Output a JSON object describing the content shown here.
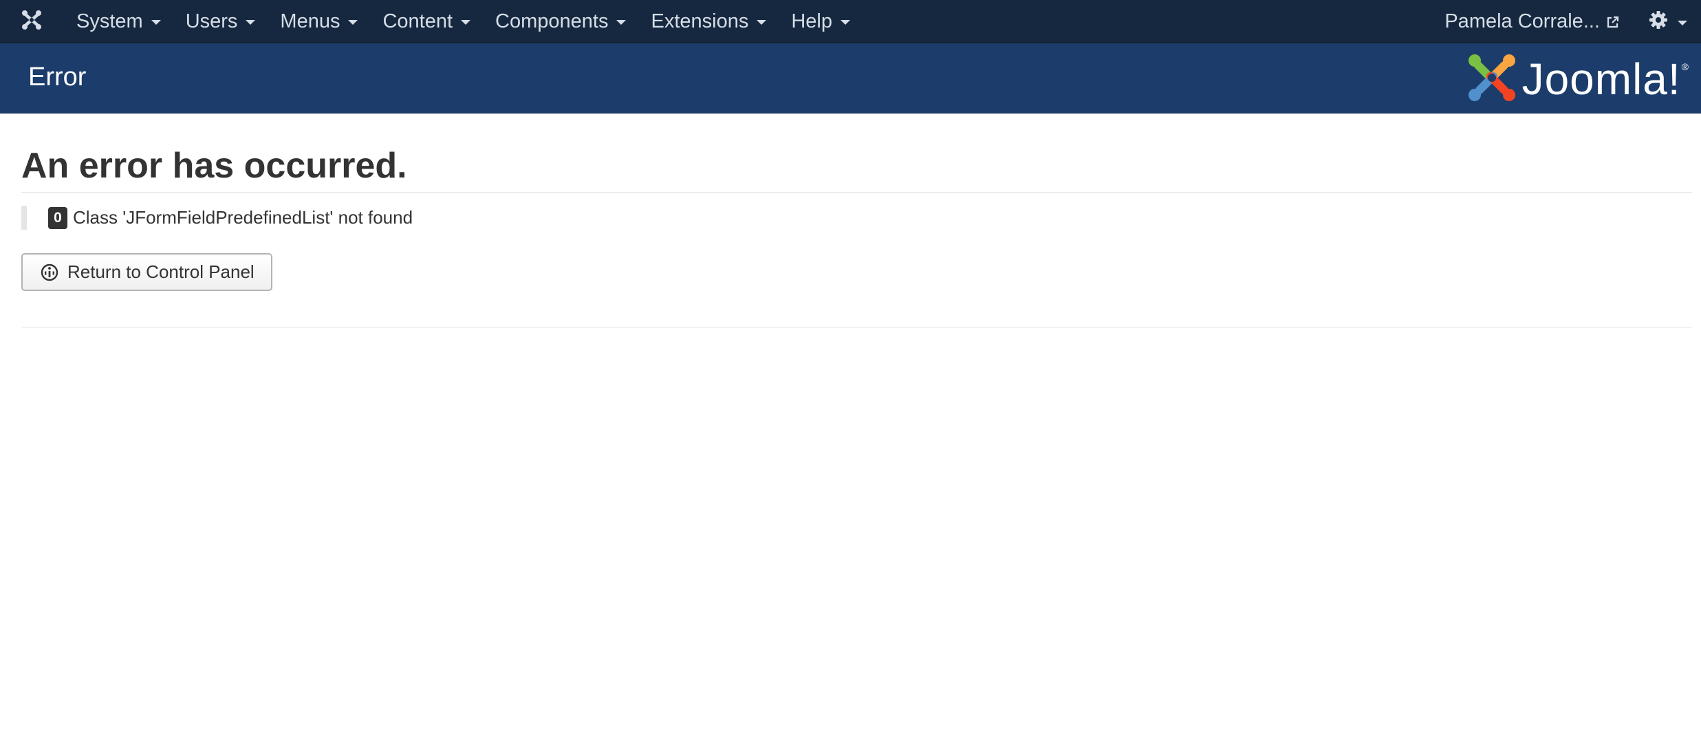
{
  "navbar": {
    "logo_icon": "joomla-icon",
    "menu": [
      {
        "label": "System"
      },
      {
        "label": "Users"
      },
      {
        "label": "Menus"
      },
      {
        "label": "Content"
      },
      {
        "label": "Components"
      },
      {
        "label": "Extensions"
      },
      {
        "label": "Help"
      }
    ],
    "user_label": "Pamela Corrale...",
    "user_icon": "external-link-icon",
    "settings_icon": "gear-icon"
  },
  "header": {
    "title": "Error",
    "brand": "Joomla!",
    "brand_mark": "®"
  },
  "main": {
    "heading": "An error has occurred.",
    "error_code": "0",
    "error_message": "Class 'JFormFieldPredefinedList' not found",
    "return_button_label": "Return to Control Panel",
    "return_button_icon": "dashboard-icon"
  },
  "colors": {
    "navbar_bg": "#16283f",
    "header_bg": "#1c3d6b",
    "text": "#333333"
  }
}
